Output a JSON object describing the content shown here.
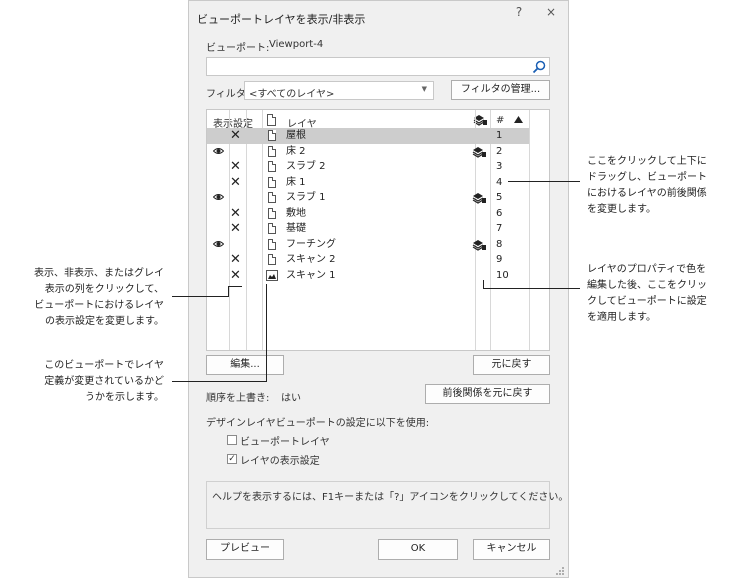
{
  "dialog": {
    "title": "ビューポートレイヤを表示/非表示",
    "help_btn": "?",
    "close_btn": "×",
    "viewport_label": "ビューポート:",
    "viewport_value": "Viewport-4",
    "search_value": "",
    "filter_label": "フィルタ:",
    "filter_value": "<すべてのレイヤ>",
    "filter_manage_btn": "フィルタの管理...",
    "columns": {
      "visibility": "表示設定",
      "layer": "レイヤ",
      "number": "#"
    },
    "layers": [
      {
        "eye": false,
        "x": true,
        "name": "屋根",
        "stack": false,
        "num": "1",
        "selected": true
      },
      {
        "eye": true,
        "x": false,
        "name": "床 2",
        "stack": true,
        "num": "2",
        "selected": false
      },
      {
        "eye": false,
        "x": true,
        "name": "スラブ 2",
        "stack": false,
        "num": "3",
        "selected": false
      },
      {
        "eye": false,
        "x": true,
        "name": "床 1",
        "stack": false,
        "num": "4",
        "selected": false
      },
      {
        "eye": true,
        "x": false,
        "name": "スラブ 1",
        "stack": true,
        "num": "5",
        "selected": false
      },
      {
        "eye": false,
        "x": true,
        "name": "敷地",
        "stack": false,
        "num": "6",
        "selected": false
      },
      {
        "eye": false,
        "x": true,
        "name": "基礎",
        "stack": false,
        "num": "7",
        "selected": false
      },
      {
        "eye": true,
        "x": false,
        "name": "フーチング",
        "stack": true,
        "num": "8",
        "selected": false
      },
      {
        "eye": false,
        "x": true,
        "name": "スキャン 2",
        "stack": false,
        "num": "9",
        "selected": false
      },
      {
        "eye": false,
        "x": true,
        "name": "スキャン 1",
        "stack": false,
        "num": "10",
        "selected": false,
        "cloud": true
      }
    ],
    "edit_btn": "編集...",
    "revert_btn": "元に戻す",
    "override_label": "順序を上書き:",
    "override_value": "はい",
    "revert_order_btn": "前後関係を元に戻す",
    "design_layer_label": "デザインレイヤビューポートの設定に以下を使用:",
    "opt_viewport_layer": "ビューポートレイヤ",
    "opt_viewport_layer_checked": false,
    "opt_layer_visibility": "レイヤの表示設定",
    "opt_layer_visibility_checked": true,
    "help_text": "ヘルプを表示するには、F1キーまたは「?」アイコンをクリックしてください。",
    "preview_btn": "プレビュー",
    "ok_btn": "OK",
    "cancel_btn": "キャンセル"
  },
  "annotations": {
    "left1": [
      "表示、非表示、またはグレイ",
      "表示の列をクリックして、",
      "ビューポートにおけるレイヤ",
      "の表示設定を変更します。"
    ],
    "left2": [
      "このビューポートでレイヤ",
      "定義が変更されているかど",
      "うかを示します。"
    ],
    "right1": [
      "ここをクリックして上下に",
      "ドラッグし、ビューポート",
      "におけるレイヤの前後関係",
      "を変更します。"
    ],
    "right2": [
      "レイヤのプロパティで色を",
      "編集した後、ここをクリッ",
      "クしてビューポートに設定",
      "を適用します。"
    ]
  }
}
